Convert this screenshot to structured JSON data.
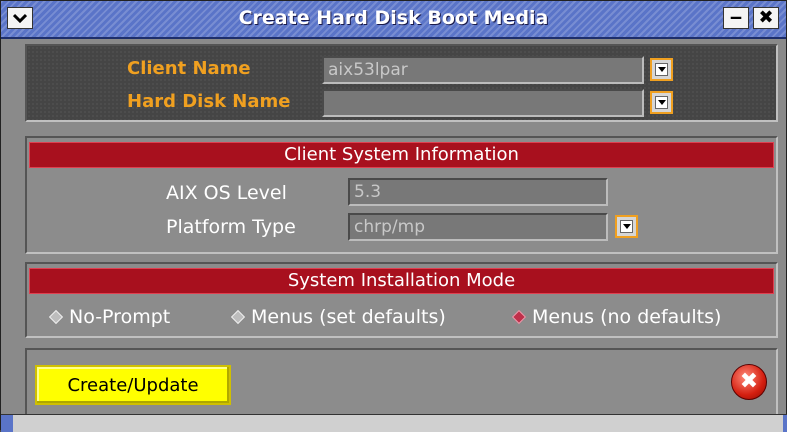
{
  "window": {
    "title": "Create Hard Disk Boot Media",
    "minimize_glyph": "‒",
    "close_glyph": "✖"
  },
  "client": {
    "name_label": "Client Name",
    "name_value": "aix53lpar",
    "disk_label": "Hard Disk Name",
    "disk_value": ""
  },
  "client_info": {
    "header": "Client System Information",
    "os_label": "AIX OS Level",
    "os_value": "5.3",
    "platform_label": "Platform Type",
    "platform_value": "chrp/mp"
  },
  "install_mode": {
    "header": "System Installation Mode",
    "options": [
      {
        "label": "No-Prompt",
        "selected": false
      },
      {
        "label": "Menus (set defaults)",
        "selected": false
      },
      {
        "label": "Menus (no defaults)",
        "selected": true
      }
    ]
  },
  "actions": {
    "create_label": "Create/Update",
    "close_glyph": "✖"
  },
  "colors": {
    "title_bar": "#5a74c8",
    "label_orange": "#f0a020",
    "banner_red": "#a8101e",
    "button_yellow": "#ffff00"
  }
}
